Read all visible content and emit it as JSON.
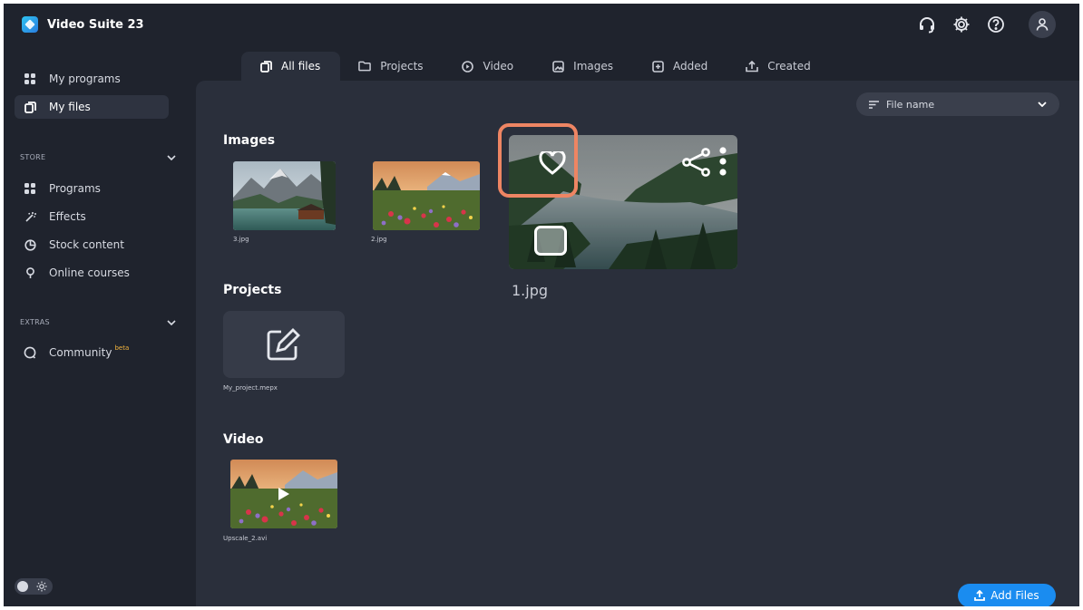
{
  "app": {
    "title": "Video Suite 23"
  },
  "topbar": {
    "icons": [
      "headset-icon",
      "gear-icon",
      "help-icon",
      "user-icon"
    ]
  },
  "sidebar": {
    "items": [
      {
        "label": "My programs",
        "icon": "grid-icon"
      },
      {
        "label": "My files",
        "icon": "files-icon",
        "active": true
      }
    ],
    "store": {
      "label": "STORE",
      "items": [
        {
          "label": "Programs",
          "icon": "grid-icon"
        },
        {
          "label": "Effects",
          "icon": "magic-wand-icon"
        },
        {
          "label": "Stock content",
          "icon": "pie-icon"
        },
        {
          "label": "Online courses",
          "icon": "lightbulb-icon"
        }
      ]
    },
    "extras": {
      "label": "EXTRAS",
      "items": [
        {
          "label": "Community",
          "badge": "beta",
          "icon": "chat-icon"
        }
      ]
    }
  },
  "tabs": [
    {
      "label": "All files",
      "active": true
    },
    {
      "label": "Projects"
    },
    {
      "label": "Video"
    },
    {
      "label": "Images"
    },
    {
      "label": "Added"
    },
    {
      "label": "Created"
    }
  ],
  "sort": {
    "label": "File name"
  },
  "sections": {
    "images": {
      "title": "Images",
      "files": [
        {
          "name": "3.jpg"
        },
        {
          "name": "2.jpg"
        },
        {
          "name": "1.jpg"
        }
      ]
    },
    "projects": {
      "title": "Projects",
      "files": [
        {
          "name": "My_project.mepx"
        }
      ]
    },
    "video": {
      "title": "Video",
      "files": [
        {
          "name": "Upscale_2.avi"
        }
      ]
    }
  },
  "actions": {
    "add_files": "Add Files"
  },
  "colors": {
    "accent": "#1a8cf0",
    "highlight": "#ee8563",
    "background": "#1f232d",
    "panel": "#2a2f3b",
    "beta": "#f2b33d"
  }
}
